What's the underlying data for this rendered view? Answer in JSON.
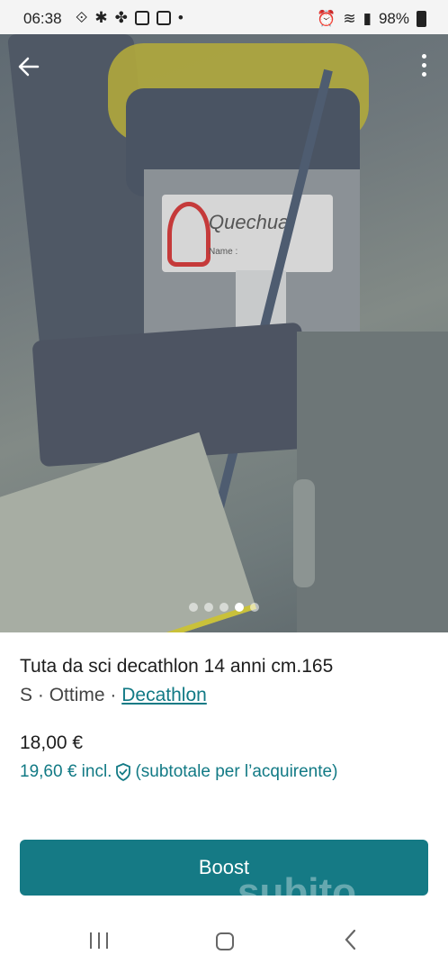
{
  "status_bar": {
    "time": "06:38",
    "battery": "98%",
    "icons": [
      "sync-icon",
      "pinwheel-icon",
      "fan-icon",
      "gallery-icon",
      "image-icon",
      "dot-icon",
      "alarm-icon",
      "wifi-icon",
      "signal-icon",
      "battery-icon"
    ]
  },
  "photo": {
    "brand_text": "Quechua",
    "name_line": "Name :",
    "page_count": 5,
    "active_page": 4
  },
  "listing": {
    "title": "Tuta da sci decathlon 14 anni cm.165",
    "size": "S",
    "separator": "·",
    "condition": "Ottime",
    "brand": "Decathlon",
    "price": "18,00 €",
    "price_incl": "19,60 € incl.",
    "price_note": "(subtotale per l’acquirente)"
  },
  "actions": {
    "boost_label": "Boost",
    "watermark": "subito"
  },
  "colors": {
    "accent": "#157a85",
    "link": "#127a85"
  }
}
